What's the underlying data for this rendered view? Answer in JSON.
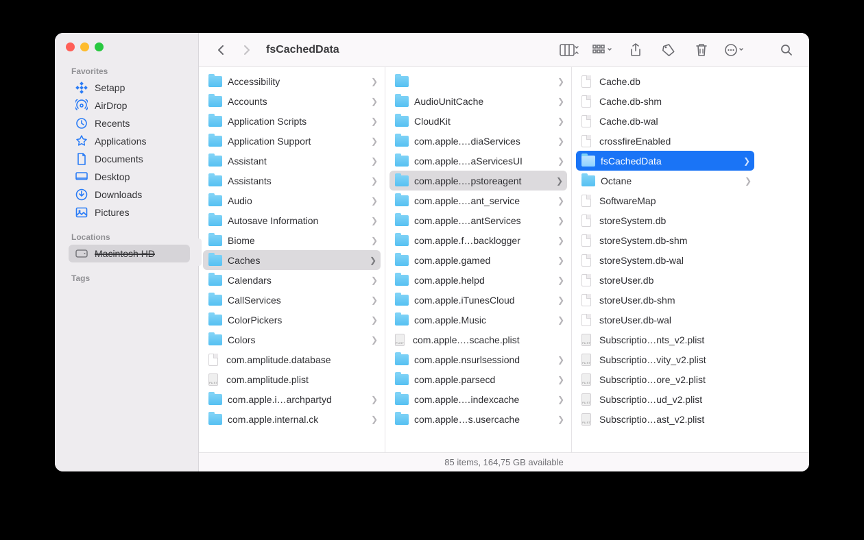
{
  "window": {
    "title": "fsCachedData"
  },
  "sidebar": {
    "favorites_label": "Favorites",
    "locations_label": "Locations",
    "tags_label": "Tags",
    "favorites": [
      {
        "id": "setapp",
        "label": "Setapp"
      },
      {
        "id": "airdrop",
        "label": "AirDrop"
      },
      {
        "id": "recents",
        "label": "Recents"
      },
      {
        "id": "applications",
        "label": "Applications"
      },
      {
        "id": "documents",
        "label": "Documents"
      },
      {
        "id": "desktop",
        "label": "Desktop"
      },
      {
        "id": "downloads",
        "label": "Downloads"
      },
      {
        "id": "pictures",
        "label": "Pictures"
      }
    ],
    "locations": [
      {
        "id": "disk",
        "label": "Macintosh HD",
        "redacted": true,
        "selected": true
      }
    ]
  },
  "columns": [
    {
      "selected_index": 9,
      "items": [
        {
          "type": "folder",
          "name": "Accessibility"
        },
        {
          "type": "folder",
          "name": "Accounts"
        },
        {
          "type": "folder",
          "name": "Application Scripts"
        },
        {
          "type": "folder",
          "name": "Application Support"
        },
        {
          "type": "folder",
          "name": "Assistant"
        },
        {
          "type": "folder",
          "name": "Assistants"
        },
        {
          "type": "folder",
          "name": "Audio"
        },
        {
          "type": "folder",
          "name": "Autosave Information"
        },
        {
          "type": "folder",
          "name": "Biome"
        },
        {
          "type": "folder",
          "name": "Caches"
        },
        {
          "type": "folder",
          "name": "Calendars"
        },
        {
          "type": "folder",
          "name": "CallServices"
        },
        {
          "type": "folder",
          "name": "ColorPickers"
        },
        {
          "type": "folder",
          "name": "Colors"
        },
        {
          "type": "file",
          "name": "com.amplitude.database"
        },
        {
          "type": "plist",
          "name": "com.amplitude.plist"
        },
        {
          "type": "folder",
          "name": "com.apple.i…archpartyd"
        },
        {
          "type": "folder",
          "name": "com.apple.internal.ck"
        }
      ]
    },
    {
      "selected_index": 5,
      "items": [
        {
          "type": "folder",
          "name": "",
          "redacted": true
        },
        {
          "type": "folder",
          "name": "AudioUnitCache"
        },
        {
          "type": "folder",
          "name": "CloudKit"
        },
        {
          "type": "folder",
          "name": "com.apple.…diaServices"
        },
        {
          "type": "folder",
          "name": "com.apple.…aServicesUI"
        },
        {
          "type": "folder",
          "name": "com.apple.…pstoreagent"
        },
        {
          "type": "folder",
          "name": "com.apple.…ant_service"
        },
        {
          "type": "folder",
          "name": "com.apple.…antServices"
        },
        {
          "type": "folder",
          "name": "com.apple.f…backlogger"
        },
        {
          "type": "folder",
          "name": "com.apple.gamed"
        },
        {
          "type": "folder",
          "name": "com.apple.helpd"
        },
        {
          "type": "folder",
          "name": "com.apple.iTunesCloud"
        },
        {
          "type": "folder",
          "name": "com.apple.Music"
        },
        {
          "type": "plist",
          "name": "com.apple.…scache.plist",
          "no_chevron": true
        },
        {
          "type": "folder",
          "name": "com.apple.nsurlsessiond"
        },
        {
          "type": "folder",
          "name": "com.apple.parsecd"
        },
        {
          "type": "folder",
          "name": "com.apple.…indexcache"
        },
        {
          "type": "folder",
          "name": "com.apple…s.usercache"
        }
      ]
    },
    {
      "selected_index": 4,
      "selected_is_active": true,
      "items": [
        {
          "type": "file",
          "name": "Cache.db"
        },
        {
          "type": "file",
          "name": "Cache.db-shm"
        },
        {
          "type": "file",
          "name": "Cache.db-wal"
        },
        {
          "type": "file",
          "name": "crossfireEnabled"
        },
        {
          "type": "folder",
          "name": "fsCachedData"
        },
        {
          "type": "folder",
          "name": "Octane"
        },
        {
          "type": "file",
          "name": "SoftwareMap"
        },
        {
          "type": "file",
          "name": "storeSystem.db"
        },
        {
          "type": "file",
          "name": "storeSystem.db-shm"
        },
        {
          "type": "file",
          "name": "storeSystem.db-wal"
        },
        {
          "type": "file",
          "name": "storeUser.db"
        },
        {
          "type": "file",
          "name": "storeUser.db-shm"
        },
        {
          "type": "file",
          "name": "storeUser.db-wal"
        },
        {
          "type": "plist",
          "name": "Subscriptio…nts_v2.plist"
        },
        {
          "type": "plist",
          "name": "Subscriptio…vity_v2.plist"
        },
        {
          "type": "plist",
          "name": "Subscriptio…ore_v2.plist"
        },
        {
          "type": "plist",
          "name": "Subscriptio…ud_v2.plist"
        },
        {
          "type": "plist",
          "name": "Subscriptio…ast_v2.plist"
        }
      ]
    }
  ],
  "status": "85 items, 164,75 GB available"
}
